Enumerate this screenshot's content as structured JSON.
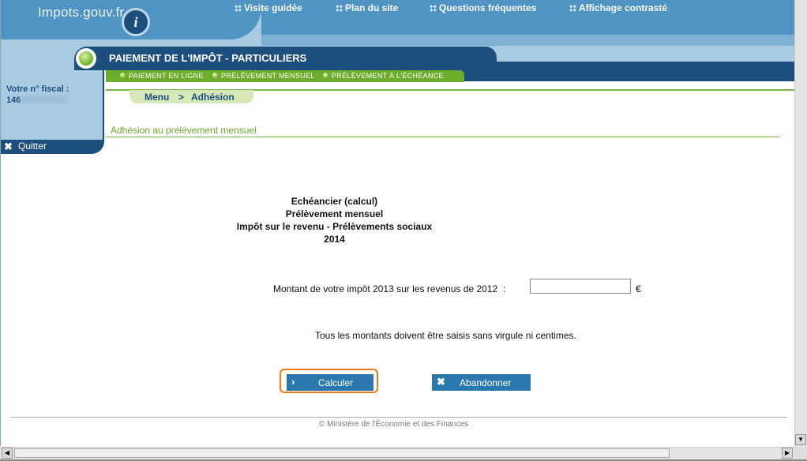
{
  "header": {
    "logo_text": "Impots.gouv.fr",
    "info_icon": "i",
    "nav": [
      {
        "label": "Visite guidée"
      },
      {
        "label": "Plan du site"
      },
      {
        "label": "Questions fréquentes"
      },
      {
        "label": "Affichage contrasté"
      }
    ]
  },
  "section": {
    "title": "PAIEMENT DE L'IMPÔT - PARTICULIERS",
    "subnav": [
      {
        "label": "PAIEMENT EN LIGNE"
      },
      {
        "label": "PRÉLÈVEMENT MENSUEL"
      },
      {
        "label": "PRÉLÈVEMENT À L'ÉCHÉANCE"
      }
    ]
  },
  "sidebar": {
    "fiscal_label": "Votre n° fiscal :",
    "fiscal_prefix": "146",
    "quit_label": "Quitter"
  },
  "breadcrumb": {
    "menu": "Menu",
    "separator": ">",
    "current": "Adhésion"
  },
  "page_heading": "Adhésion au prélèvement mensuel",
  "main": {
    "titles": [
      "Echéancier (calcul)",
      "Prélèvement mensuel",
      "Impôt sur le revenu - Prélèvements sociaux",
      "2014"
    ],
    "amount_label": "Montant de votre impôt 2013 sur les revenus de 2012  :",
    "amount_value": "",
    "currency": "€",
    "note": "Tous les montants doivent être saisis sans virgule ni centimes.",
    "calc_button": "Calculer",
    "abandon_button": "Abandonner"
  },
  "footer": "© Ministère de l'Économie et des Finances",
  "colors": {
    "dark_blue": "#1d4f7e",
    "mid_blue": "#4f94c2",
    "light_blue": "#a9cbe2",
    "green": "#6cae2c",
    "button_blue": "#2a78ae",
    "focus_orange": "#f07a1a"
  },
  "icons": {
    "quit": "close-icon",
    "calc": "chevron-right-icon",
    "abandon": "close-icon"
  }
}
